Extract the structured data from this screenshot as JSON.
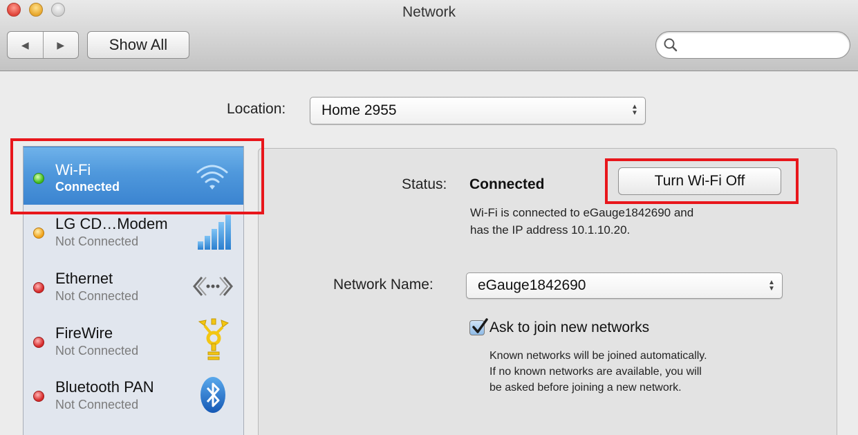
{
  "window": {
    "title": "Network"
  },
  "toolbar": {
    "back_glyph": "◀",
    "forward_glyph": "▶",
    "show_all_label": "Show All",
    "search_placeholder": "",
    "search_value": ""
  },
  "location": {
    "label": "Location:",
    "value": "Home 2955"
  },
  "services": [
    {
      "name": "Wi-Fi",
      "status": "Connected",
      "status_color": "green",
      "icon": "wifi-icon",
      "selected": true
    },
    {
      "name": "LG CD…Modem",
      "status": "Not Connected",
      "status_color": "yellow",
      "icon": "signal-bars-icon",
      "selected": false
    },
    {
      "name": "Ethernet",
      "status": "Not Connected",
      "status_color": "red",
      "icon": "ethernet-icon",
      "selected": false
    },
    {
      "name": "FireWire",
      "status": "Not Connected",
      "status_color": "red",
      "icon": "firewire-icon",
      "selected": false
    },
    {
      "name": "Bluetooth PAN",
      "status": "Not Connected",
      "status_color": "red",
      "icon": "bluetooth-icon",
      "selected": false
    }
  ],
  "detail": {
    "status_label": "Status:",
    "status_value": "Connected",
    "turn_off_label": "Turn Wi-Fi Off",
    "status_desc_line1": "Wi-Fi is connected to eGauge1842690 and",
    "status_desc_line2": "has the IP address 10.1.10.20.",
    "network_name_label": "Network Name:",
    "network_name_value": "eGauge1842690",
    "ask_join_label": "Ask to join new networks",
    "ask_join_checked": true,
    "help_line1": "Known networks will be joined automatically.",
    "help_line2": "If no known networks are available, you will",
    "help_line3": "be asked before joining a new network."
  },
  "colors": {
    "selection_blue": "#4f98dc",
    "annotation_red": "#e8161b",
    "status_green": "#3fbb1f",
    "status_yellow": "#f0a31b",
    "status_red": "#d62a2a"
  }
}
